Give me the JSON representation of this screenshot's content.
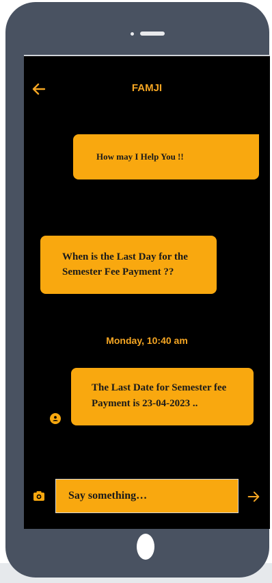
{
  "chat": {
    "title": "FAMJI",
    "messages": [
      {
        "text": "How may I Help You !!"
      },
      {
        "text": "When is the Last Day for the Semester Fee Payment ??"
      },
      {
        "text": "The Last Date for Semester fee Payment is 23-04-2023 .."
      }
    ],
    "timestamp": "Monday, 10:40 am"
  },
  "composer": {
    "placeholder": "Say something…"
  },
  "icons": {
    "back": "arrow-left-icon",
    "avatar": "user-avatar-icon",
    "camera": "camera-icon",
    "send": "arrow-right-icon"
  },
  "colors": {
    "accent": "#f9a80f",
    "screen_bg": "#000000",
    "phone_body": "#495261"
  }
}
